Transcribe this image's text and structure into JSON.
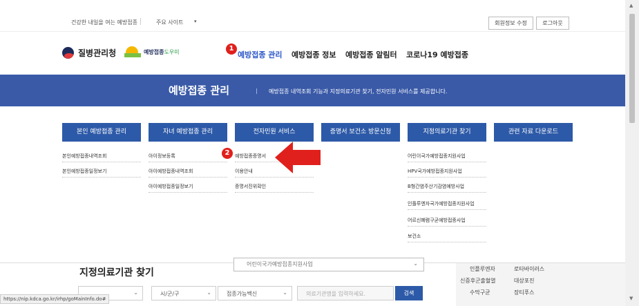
{
  "util": {
    "slogan": "건강한 내일을 여는 예방접종",
    "sites_label": "주요 사이트",
    "caret": "▾",
    "edit_profile": "회원정보 수정",
    "logout": "로그아웃"
  },
  "header": {
    "org_name": "질병관리청",
    "helper_name": "예방접종",
    "helper_name_suffix": "도우미",
    "nav": [
      "예방접종 관리",
      "예방접종 정보",
      "예방접종 알림터",
      "코로나19 예방접종"
    ],
    "badge1": "1",
    "badge2": "2"
  },
  "banner": {
    "title": "예방접종 관리",
    "desc": "예방접종 내역조회 기능과 지정의료기관 찾기, 전자민원 서비스를 제공합니다."
  },
  "menu": {
    "columns": [
      {
        "title": "본인 예방접종 관리",
        "items": [
          "본인예방접종내역조회",
          "본인예방접종일정보기"
        ]
      },
      {
        "title": "자녀 예방접종 관리",
        "items": [
          "아이정보등록",
          "아이예방접종내역조회",
          "아이예방접종일정보기"
        ]
      },
      {
        "title": "전자민원 서비스",
        "items": [
          "예방접종증명서",
          "이용안내",
          "증명서진위확인"
        ]
      },
      {
        "title": "증명서 보건소 방문신청",
        "items": []
      },
      {
        "title": "지정의료기관 찾기",
        "items": [
          "어린이국가예방접종지원사업",
          "HPV국가예방접종지원사업",
          "B형간염주산기감염예방사업",
          "인플루엔자국가예방접종지원사업",
          "어르신폐렴구균예방접종사업",
          "보건소"
        ]
      },
      {
        "title": "관련 자료 다운로드",
        "items": []
      }
    ]
  },
  "finder": {
    "title": "지정의료기관 찾기",
    "program_select": "어린이국가예방접종지원사업",
    "city_select": "시/군/구",
    "vaccine_select": "접종가능백신",
    "search_placeholder": "의료기관명을 입력하세요.",
    "search_button": "검색",
    "side_items": [
      "인플루엔자",
      "로타바이러스",
      "신증후군출혈열",
      "대상포진",
      "수막구균",
      "장티푸스"
    ]
  },
  "status_url": "https://nip.kdca.go.kr/irhp/goMainInfo.do#",
  "colors": {
    "brand_blue": "#2d5aa8",
    "banner_blue": "#3a5aa8",
    "active_nav": "#2b56c8",
    "badge_red": "#e0201c",
    "arrow_red": "#e0201c"
  }
}
